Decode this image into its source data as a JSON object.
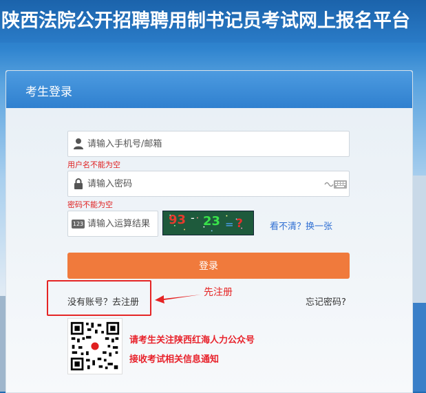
{
  "header": {
    "title": "陕西法院公开招聘聘用制书记员考试网上报名平台"
  },
  "login_panel": {
    "title": "考生登录",
    "username": {
      "placeholder": "请输入手机号/邮箱",
      "error": "用户名不能为空"
    },
    "password": {
      "placeholder": "请输入密码",
      "error": "密码不能为空"
    },
    "captcha": {
      "placeholder": "请输入运算结果",
      "image_text": {
        "a": "93",
        "op": "-",
        "b": "23",
        "eq": "=",
        "q": "?"
      },
      "refresh_label": "看不清？换一张",
      "icon_text": "123"
    },
    "login_button": "登录",
    "register_link": "没有账号？去注册",
    "forgot_link": "忘记密码?",
    "annotation": "先注册",
    "notice_line1": "请考生关注陕西红海人力公众号",
    "notice_line2": "接收考试相关信息通知"
  },
  "colors": {
    "accent_orange": "#f07a3c",
    "header_blue": "#2f80cf",
    "error_red": "#e02020",
    "link_blue": "#2f6fd3"
  }
}
